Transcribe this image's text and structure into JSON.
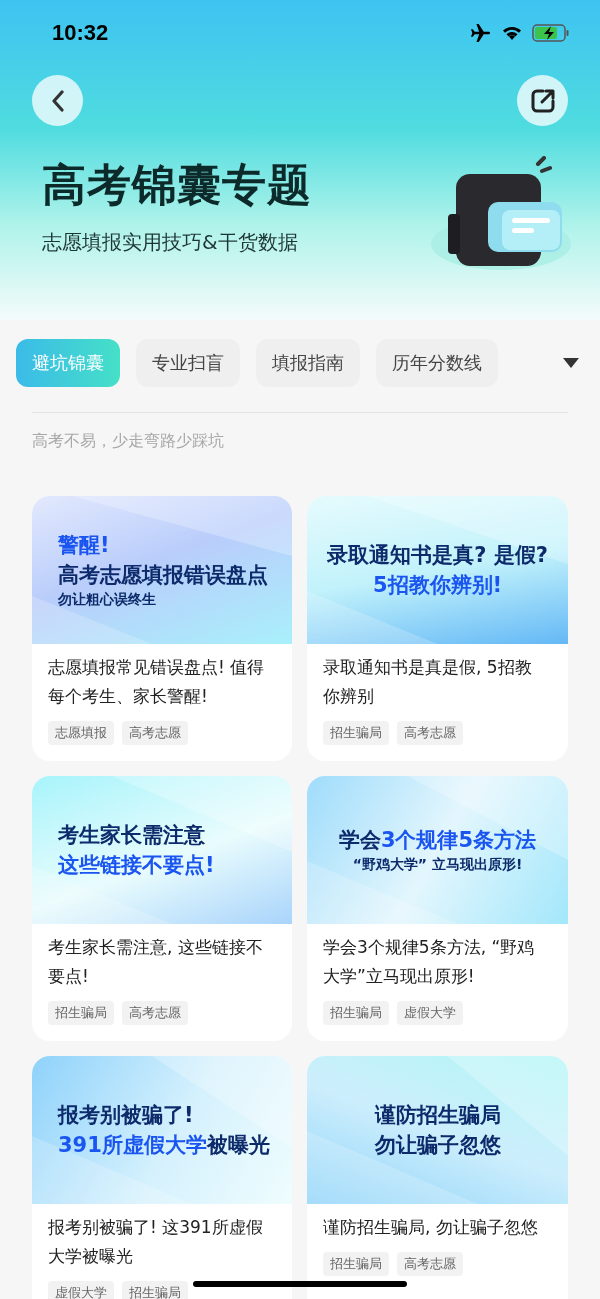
{
  "status_bar": {
    "time": "10:32"
  },
  "header": {
    "title": "高考锦囊专题",
    "subtitle": "志愿填报实用技巧&干货数据"
  },
  "tabs": [
    {
      "label": "避坑锦囊",
      "selected": true
    },
    {
      "label": "专业扫盲",
      "selected": false
    },
    {
      "label": "填报指南",
      "selected": false
    },
    {
      "label": "历年分数线",
      "selected": false
    }
  ],
  "caption": "高考不易，少走弯路少踩坑",
  "articles": [
    {
      "banner": {
        "kind": "left",
        "lines": [
          {
            "kind": "headline",
            "segments": [
              {
                "text": "警醒!",
                "accent": true
              }
            ]
          },
          {
            "kind": "headline",
            "segments": [
              {
                "text": "高考志愿填报错误盘点",
                "accent": false
              }
            ]
          },
          {
            "kind": "sub",
            "segments": [
              {
                "text": "勿让粗心误终生",
                "accent": false
              }
            ]
          }
        ]
      },
      "title": "志愿填报常见错误盘点! 值得每个考生、家长警醒!",
      "tags": [
        "志愿填报",
        "高考志愿"
      ]
    },
    {
      "banner": {
        "kind": "centered",
        "lines": [
          {
            "kind": "headline",
            "segments": [
              {
                "text": "录取通知书是真? 是假?",
                "accent": false
              }
            ]
          },
          {
            "kind": "headline",
            "segments": [
              {
                "text": "5招教你辨别!",
                "accent": true
              }
            ]
          }
        ]
      },
      "title": "录取通知书是真是假, 5招教你辨别",
      "tags": [
        "招生骗局",
        "高考志愿"
      ]
    },
    {
      "banner": {
        "kind": "left",
        "lines": [
          {
            "kind": "headline",
            "segments": [
              {
                "text": "考生家长需注意",
                "accent": false
              }
            ]
          },
          {
            "kind": "headline",
            "segments": [
              {
                "text": "这些链接不要点!",
                "accent": true
              }
            ]
          }
        ]
      },
      "title": "考生家长需注意, 这些链接不要点!",
      "tags": [
        "招生骗局",
        "高考志愿"
      ]
    },
    {
      "banner": {
        "kind": "centered",
        "lines": [
          {
            "kind": "headline",
            "segments": [
              {
                "text": "学会",
                "accent": false
              },
              {
                "text": "3个规律5条方法",
                "accent": true
              }
            ]
          },
          {
            "kind": "sub",
            "segments": [
              {
                "text": "“野鸡大学” 立马现出原形!",
                "accent": false
              }
            ]
          }
        ]
      },
      "title": "学会3个规律5条方法, “野鸡大学”立马现出原形!",
      "tags": [
        "招生骗局",
        "虚假大学"
      ]
    },
    {
      "banner": {
        "kind": "left",
        "lines": [
          {
            "kind": "headline",
            "segments": [
              {
                "text": "报考别被骗了!",
                "accent": false
              }
            ]
          },
          {
            "kind": "headline",
            "segments": [
              {
                "text": "391所虚假大学",
                "accent": true
              },
              {
                "text": "被曝光",
                "accent": false
              }
            ]
          }
        ]
      },
      "title": "报考别被骗了! 这391所虚假大学被曝光",
      "tags": [
        "虚假大学",
        "招生骗局"
      ]
    },
    {
      "banner": {
        "kind": "centered",
        "lines": [
          {
            "kind": "headline",
            "segments": [
              {
                "text": "谨防招生骗局",
                "accent": false
              }
            ]
          },
          {
            "kind": "headline",
            "segments": [
              {
                "text": "勿让骗子忽悠",
                "accent": false
              }
            ]
          }
        ]
      },
      "title": "谨防招生骗局, 勿让骗子忽悠",
      "tags": [
        "招生骗局",
        "高考志愿"
      ]
    }
  ]
}
